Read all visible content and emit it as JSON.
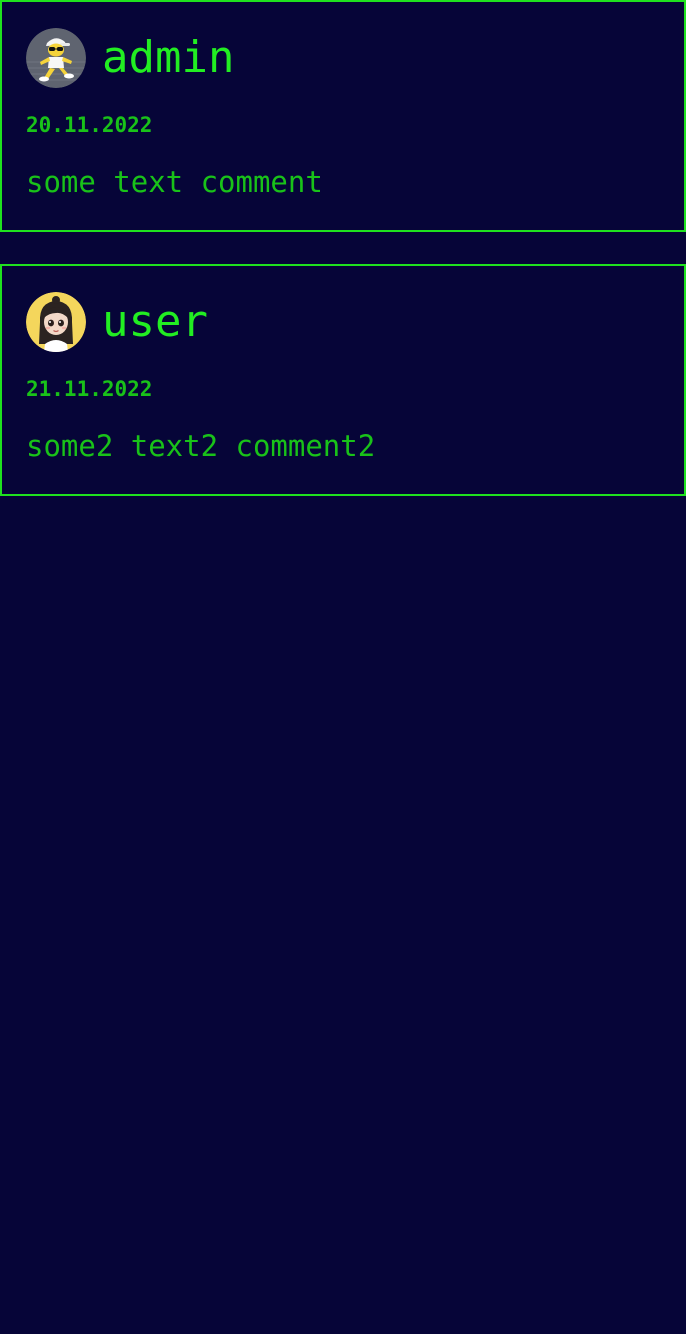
{
  "comments": [
    {
      "username": "admin",
      "date": "20.11.2022",
      "text": "some text comment",
      "avatar_icon": "cartoon-character-cap-sunglasses-avatar-icon"
    },
    {
      "username": "user",
      "date": "21.11.2022",
      "text": "some2 text2 comment2",
      "avatar_icon": "cartoon-girl-avatar-icon"
    }
  ],
  "colors": {
    "background": "#060538",
    "border": "#1fe21f",
    "username": "#22ee22",
    "text": "#19c219"
  }
}
